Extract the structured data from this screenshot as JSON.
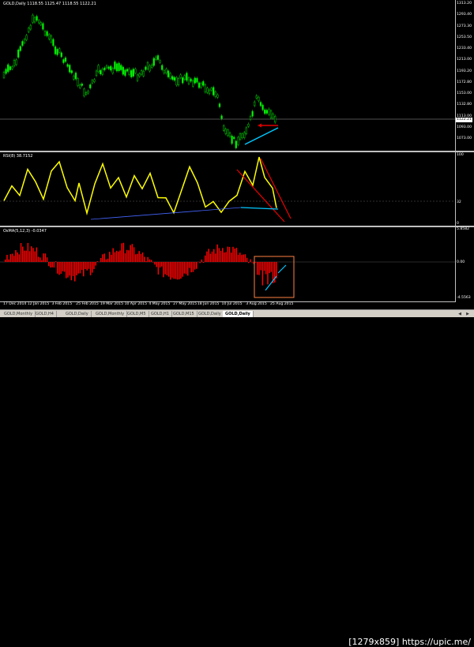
{
  "chart": {
    "main_label": "GOLD,Daily  1118.55 1125.47 1118.55 1122.21",
    "rsi_label": "RSI(8) 38.7152",
    "osma_label": "OsMA(5,12,3) -0.0347",
    "current_price": "1122.21",
    "price_ticks": [
      "1313.20",
      "1293.40",
      "1273.30",
      "1253.50",
      "1233.40",
      "1213.00",
      "1193.20",
      "1172.80",
      "1153.00",
      "1132.80",
      "1113.00",
      "1093.00",
      "1073.00"
    ],
    "rsi_ticks": [
      "100",
      "32",
      "0"
    ],
    "osma_ticks": [
      "5.8582",
      "0.00",
      "-4.5563"
    ],
    "date_ticks": [
      "17 Dec 2014",
      "12 Jan 2015",
      "3 Feb 2015",
      "25 Feb 2015",
      "19 Mar 2015",
      "10 Apr 2015",
      "4 May 2015",
      "27 May 2015",
      "18 Jun 2015",
      "10 Jul 2015",
      "3 Aug 2015",
      "25 Aug 2015"
    ],
    "colors": {
      "bull": "#00d000",
      "bear": "#00ff00",
      "rsi": "#ffff00",
      "osma": "#ff0000",
      "trend_red": "#e00000",
      "trend_cyan": "#00c8ff",
      "box": "#ff8040"
    }
  },
  "tabs": [
    {
      "label": "GOLD,Monthly"
    },
    {
      "label": "GOLD,H4"
    },
    {
      "label": "GOLD,Daily"
    },
    {
      "label": "GOLD,Monthly"
    },
    {
      "label": "GOLD,M5"
    },
    {
      "label": "GOLD,H1"
    },
    {
      "label": "GOLD,M15"
    },
    {
      "label": "GOLD,Daily"
    },
    {
      "label": "GOLD,Daily",
      "active": true
    }
  ],
  "watermark": "[1279x859] https://upic.me/"
}
